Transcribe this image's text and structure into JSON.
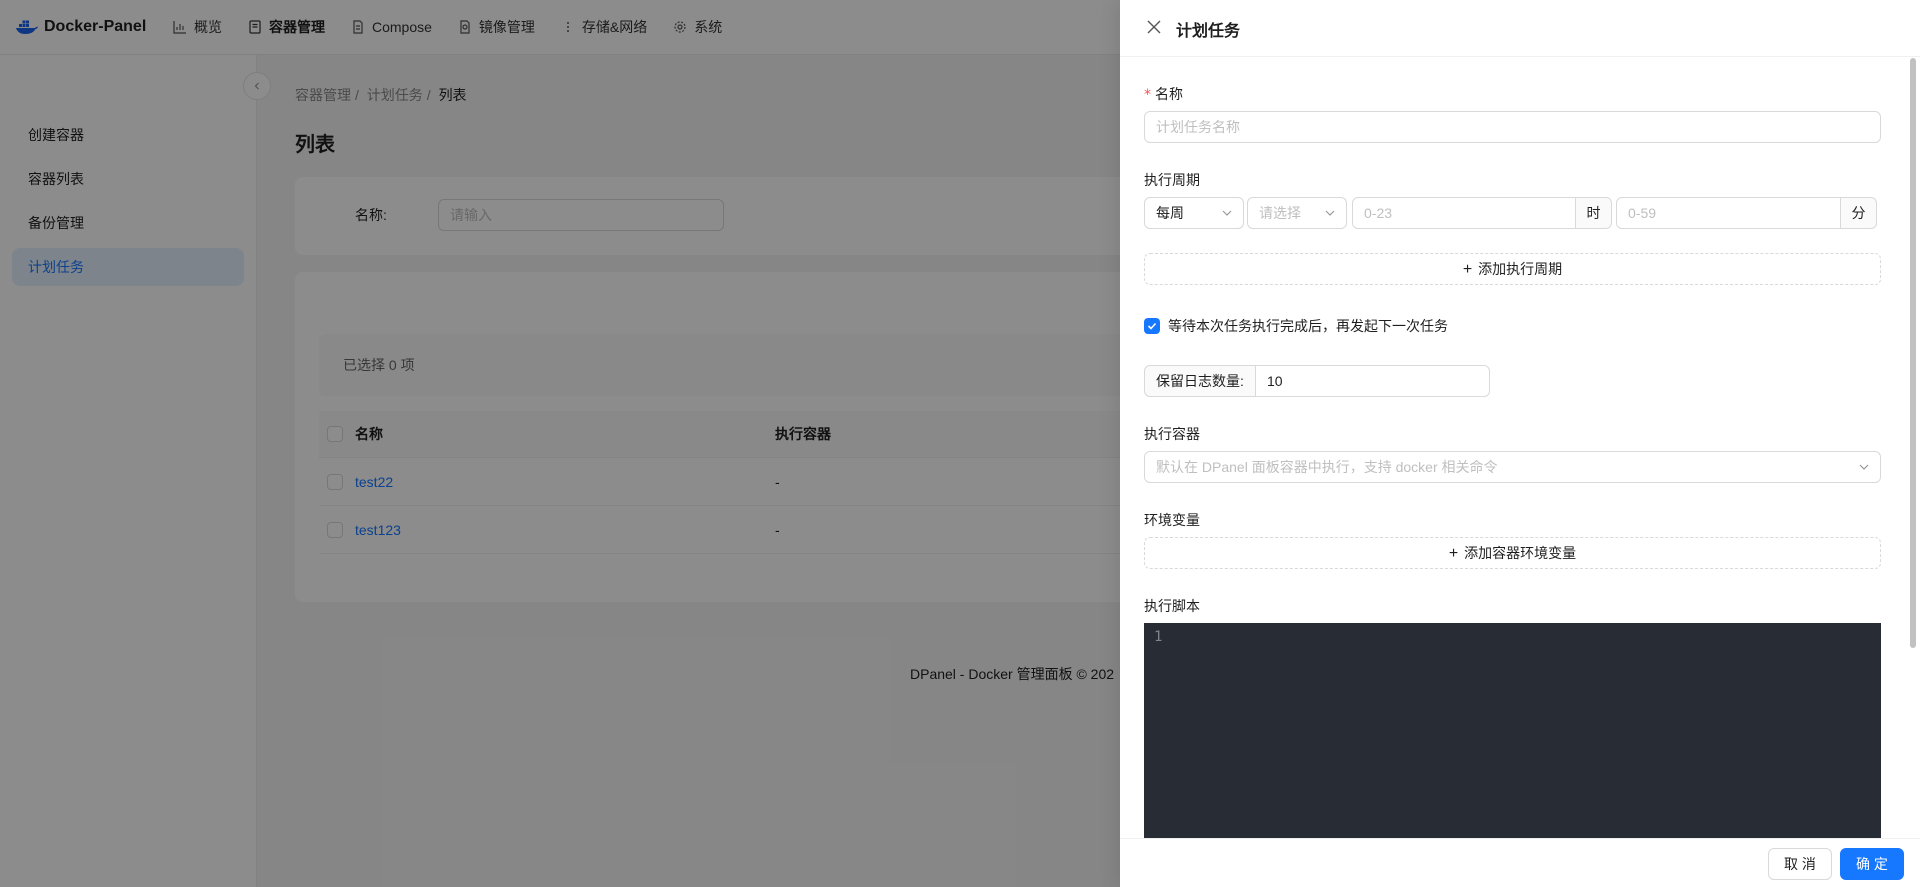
{
  "app": {
    "brand": "Docker-Panel",
    "brand_color": "#1d63ed",
    "nav": [
      {
        "label": "概览",
        "icon": "chart-icon"
      },
      {
        "label": "容器管理",
        "icon": "container-icon",
        "active": true
      },
      {
        "label": "Compose",
        "icon": "file-icon"
      },
      {
        "label": "镜像管理",
        "icon": "image-icon"
      },
      {
        "label": "存储&网络",
        "icon": "more-vertical-icon"
      },
      {
        "label": "系统",
        "icon": "gear-icon"
      }
    ]
  },
  "sidebar": {
    "items": [
      {
        "label": "创建容器"
      },
      {
        "label": "容器列表"
      },
      {
        "label": "备份管理"
      },
      {
        "label": "计划任务",
        "active": true
      }
    ]
  },
  "main": {
    "breadcrumb": [
      "容器管理",
      "计划任务",
      "列表"
    ],
    "title": "列表",
    "search": {
      "label": "名称:",
      "placeholder": "请输入"
    },
    "selected_text": "已选择  0  项",
    "table": {
      "columns": [
        "名称",
        "执行容器"
      ],
      "rows": [
        {
          "name": "test22",
          "container": "-"
        },
        {
          "name": "test123",
          "container": "-"
        }
      ]
    },
    "footer": "DPanel - Docker 管理面板 © 202"
  },
  "drawer": {
    "title": "计划任务",
    "name": {
      "label": "名称",
      "placeholder": "计划任务名称"
    },
    "period": {
      "label": "执行周期",
      "type_value": "每周",
      "day_placeholder": "请选择",
      "hour_placeholder": "0-23",
      "hour_unit": "时",
      "minute_placeholder": "0-59",
      "minute_unit": "分",
      "add_label": "添加执行周期"
    },
    "wait_checkbox": {
      "label": "等待本次任务执行完成后，再发起下一次任务",
      "checked": true
    },
    "log_keep": {
      "label": "保留日志数量:",
      "value": "10"
    },
    "container": {
      "label": "执行容器",
      "placeholder": "默认在 DPanel 面板容器中执行，支持 docker 相关命令"
    },
    "env": {
      "label": "环境变量",
      "add_label": "添加容器环境变量"
    },
    "script": {
      "label": "执行脚本",
      "line_number": "1"
    },
    "buttons": {
      "cancel": "取 消",
      "ok": "确 定"
    },
    "accent": "#1677ff"
  }
}
